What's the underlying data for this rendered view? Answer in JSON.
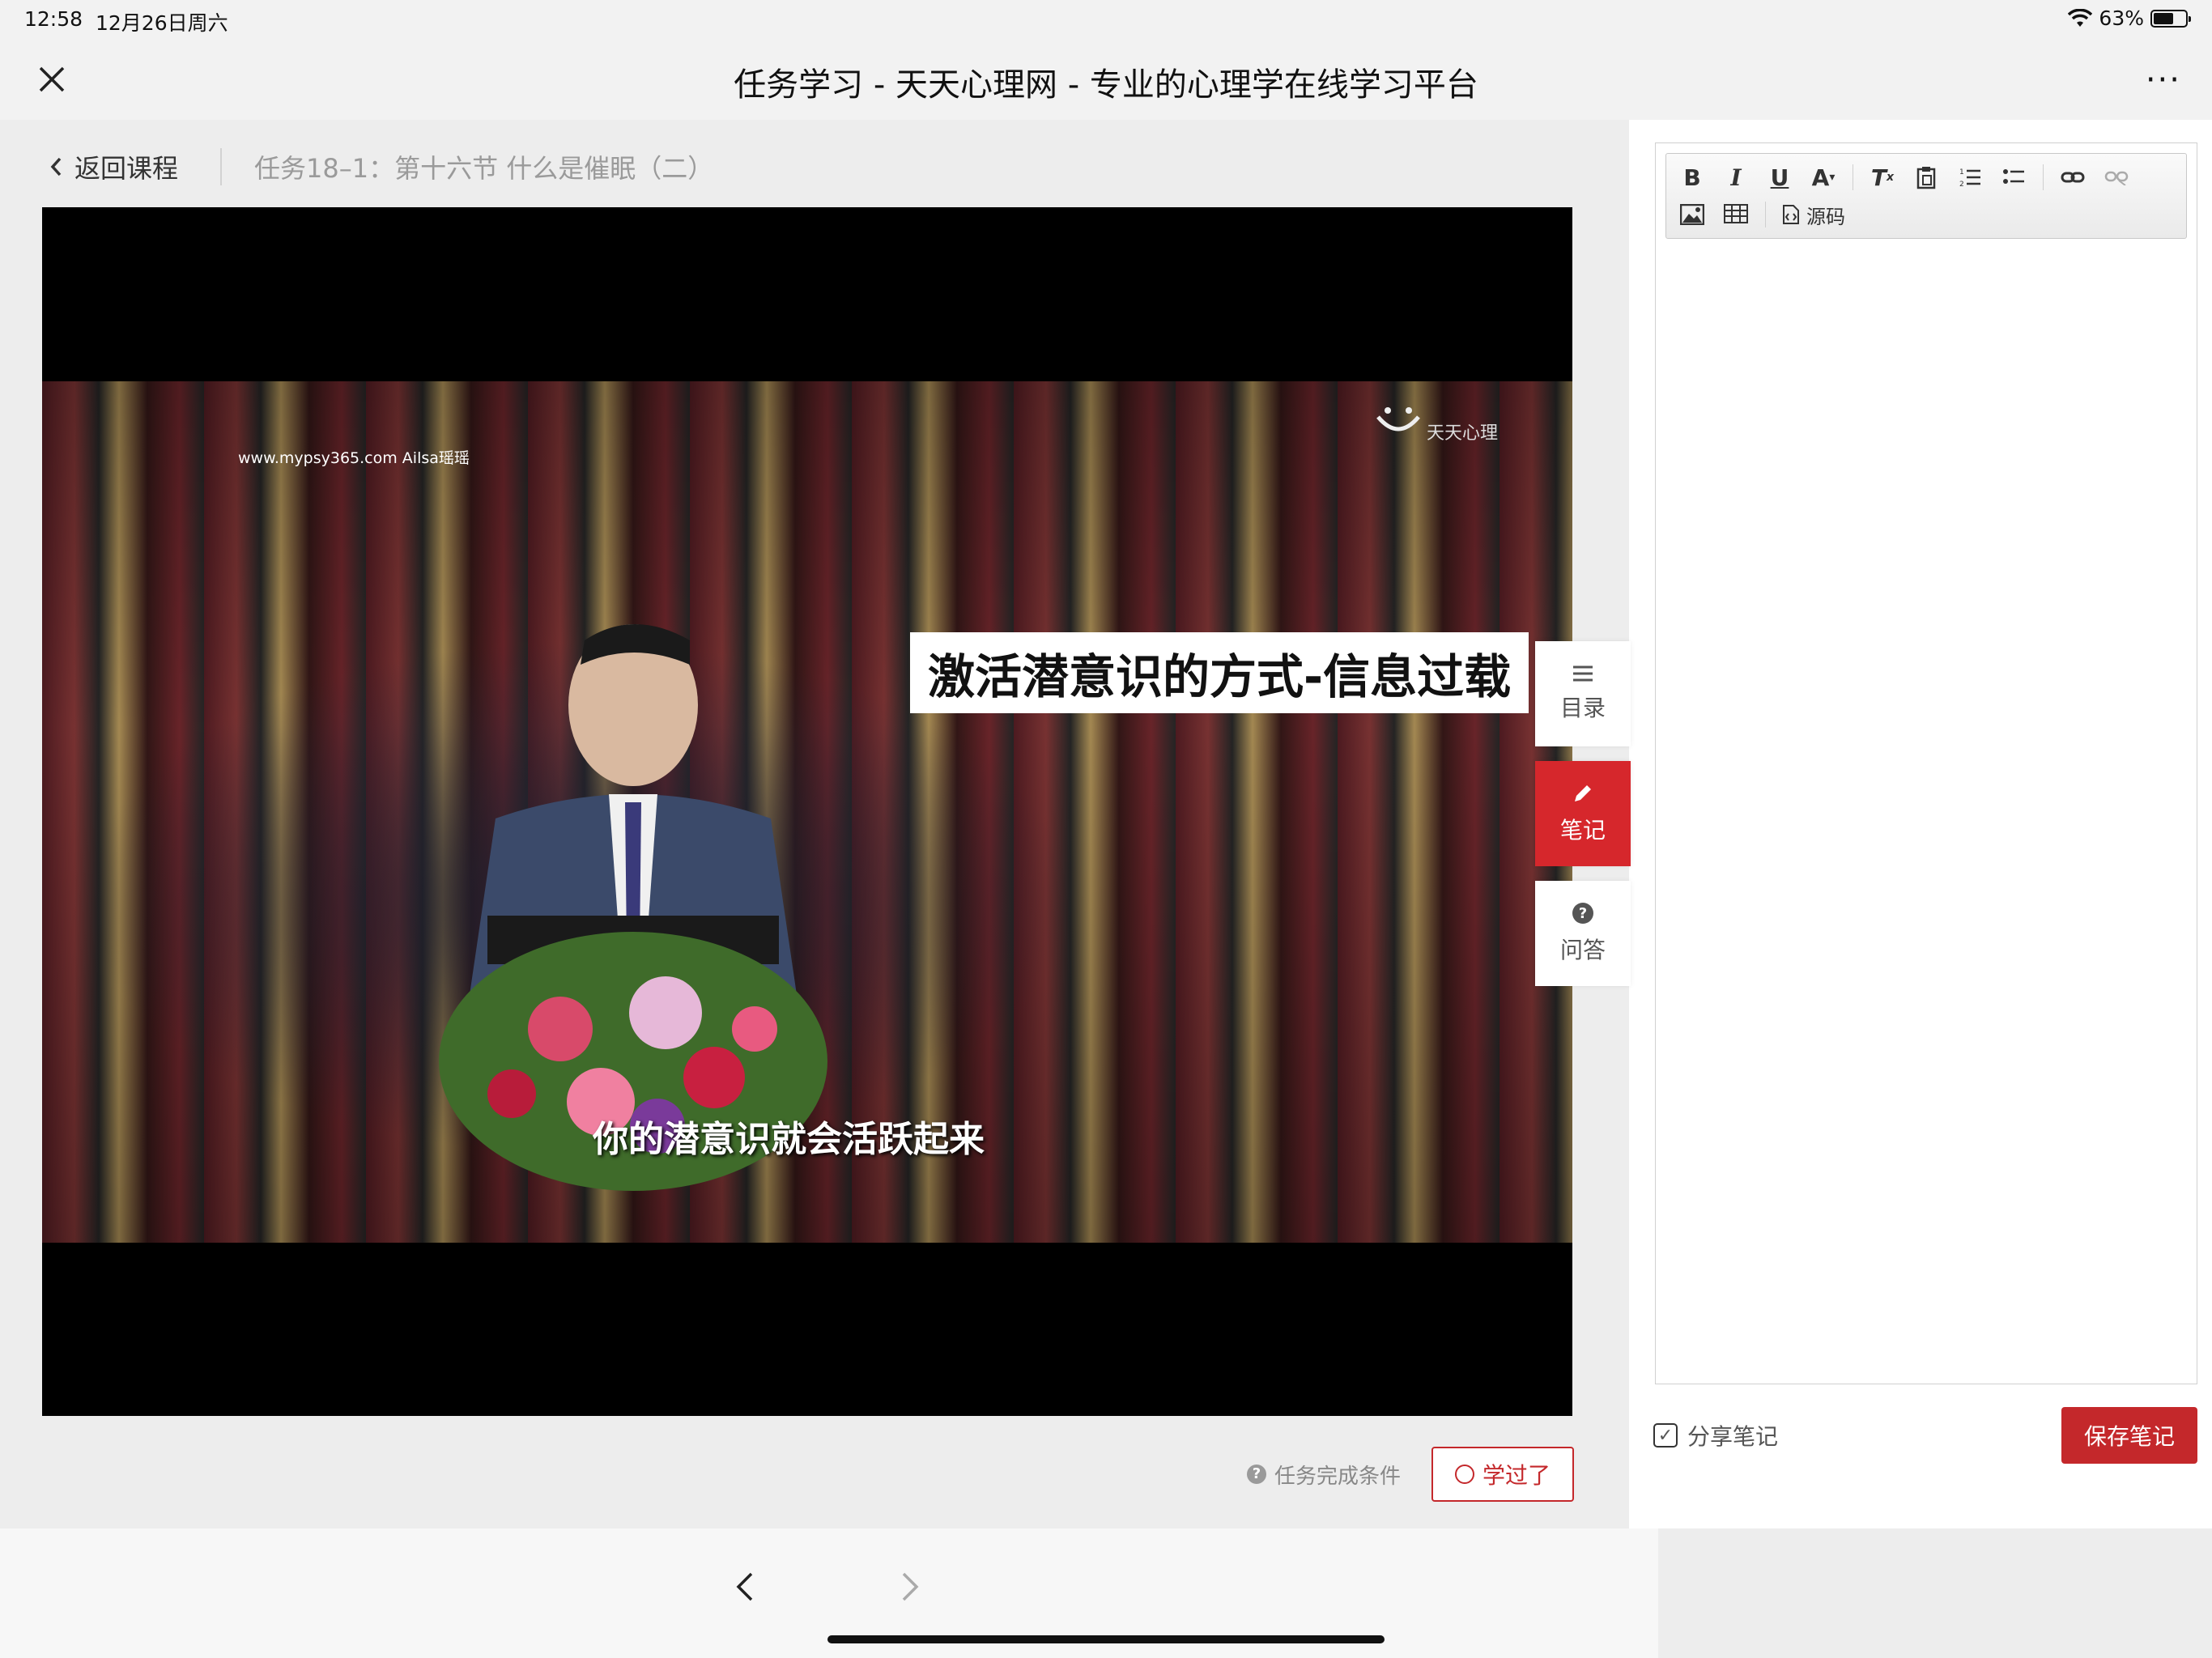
{
  "status": {
    "time": "12:58",
    "date": "12月26日周六",
    "battery": "63%",
    "battery_level": 0.63
  },
  "nav": {
    "title": "任务学习 - 天天心理网 - 专业的心理学在线学习平台",
    "close_icon": "close-icon",
    "more": "···"
  },
  "breadcrumb": {
    "back_label": "返回课程",
    "task_title": "任务18–1：第十六节 什么是催眠（二）"
  },
  "video": {
    "watermark": "www.mypsy365.com Ailsa瑶瑶",
    "logo_text": "天天心理",
    "caption": "激活潜意识的方式-信息过载",
    "subtitle": "你的潜意识就会活跃起来"
  },
  "completion": {
    "condition_label": "任务完成条件",
    "learned_label": "学过了"
  },
  "side_tabs": [
    {
      "label": "目录",
      "icon": "list-icon"
    },
    {
      "label": "笔记",
      "icon": "pencil-icon"
    },
    {
      "label": "问答",
      "icon": "question-icon"
    }
  ],
  "notes": {
    "toolbar": {
      "source_label": "源码"
    },
    "share_label": "分享笔记",
    "share_checked": true,
    "save_label": "保存笔记"
  },
  "colors": {
    "accent": "#c4282b",
    "active_tab": "#d6272c"
  }
}
